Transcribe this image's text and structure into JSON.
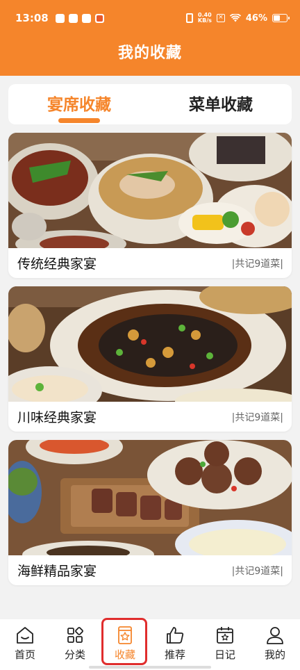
{
  "status_bar": {
    "time": "13:08",
    "net_speed_value": "0.40",
    "net_speed_unit": "KB/s",
    "battery": "46%"
  },
  "header": {
    "title": "我的收藏"
  },
  "tabs": [
    {
      "label": "宴席收藏",
      "active": true
    },
    {
      "label": "菜单收藏",
      "active": false
    }
  ],
  "cards": [
    {
      "title": "传统经典家宴",
      "count": "|共记9道菜|"
    },
    {
      "title": "川味经典家宴",
      "count": "|共记9道菜|"
    },
    {
      "title": "海鲜精品家宴",
      "count": "|共记9道菜|"
    }
  ],
  "nav": [
    {
      "label": "首页",
      "icon": "home-icon"
    },
    {
      "label": "分类",
      "icon": "grid-icon"
    },
    {
      "label": "收藏",
      "icon": "star-bookmark-icon",
      "active": true
    },
    {
      "label": "推荐",
      "icon": "thumbs-up-icon"
    },
    {
      "label": "日记",
      "icon": "calendar-icon"
    },
    {
      "label": "我的",
      "icon": "user-icon"
    }
  ],
  "colors": {
    "accent": "#f5852b",
    "highlight": "#e02d2d"
  }
}
